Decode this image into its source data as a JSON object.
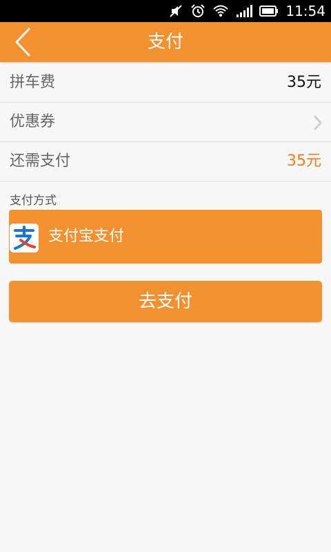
{
  "status_bar": {
    "time": "11:54",
    "icons": [
      "mute-icon",
      "alarm-icon",
      "wifi-icon",
      "signal-icon",
      "battery-icon"
    ]
  },
  "header": {
    "title": "支付",
    "back_icon": "chevron-left-icon"
  },
  "rows": {
    "fare": {
      "label": "拼车费",
      "value": "35元"
    },
    "coupon": {
      "label": "优惠券",
      "icon": "chevron-right-icon"
    },
    "due": {
      "label": "还需支付",
      "value": "35元"
    }
  },
  "payment": {
    "section_label": "支付方式",
    "method_label": "支付宝支付",
    "method_icon": "alipay-icon"
  },
  "submit_label": "去支付",
  "colors": {
    "accent": "#f39030",
    "amount_due": "#f37b1d",
    "background": "#f7f7f7"
  }
}
